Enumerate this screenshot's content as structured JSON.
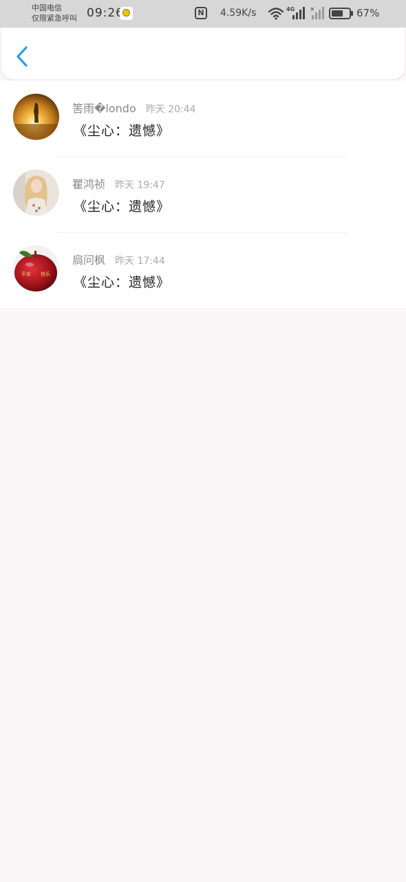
{
  "status_bar": {
    "carrier_line1": "中国电信",
    "carrier_line2": "仅限紧急呼叫",
    "time": "09:26",
    "nfc_label": "N",
    "network_speed": "4.59K/s",
    "network_type": "4G",
    "battery_percent": "67%",
    "battery_level": 0.67
  },
  "header": {
    "back_icon": "chevron-left-icon",
    "accent_color": "#2a9ee6"
  },
  "items": [
    {
      "name": "筈雨�londo",
      "time": "昨天 20:44",
      "message": "《尘心：遗憾》",
      "avatar": "sunset-silhouette"
    },
    {
      "name": "瞿鸿祯",
      "time": "昨天 19:47",
      "message": "《尘心：遗憾》",
      "avatar": "blonde-woman"
    },
    {
      "name": "扃问枫",
      "time": "昨天 17:44",
      "message": "《尘心：遗憾》",
      "avatar": "red-apple"
    }
  ]
}
